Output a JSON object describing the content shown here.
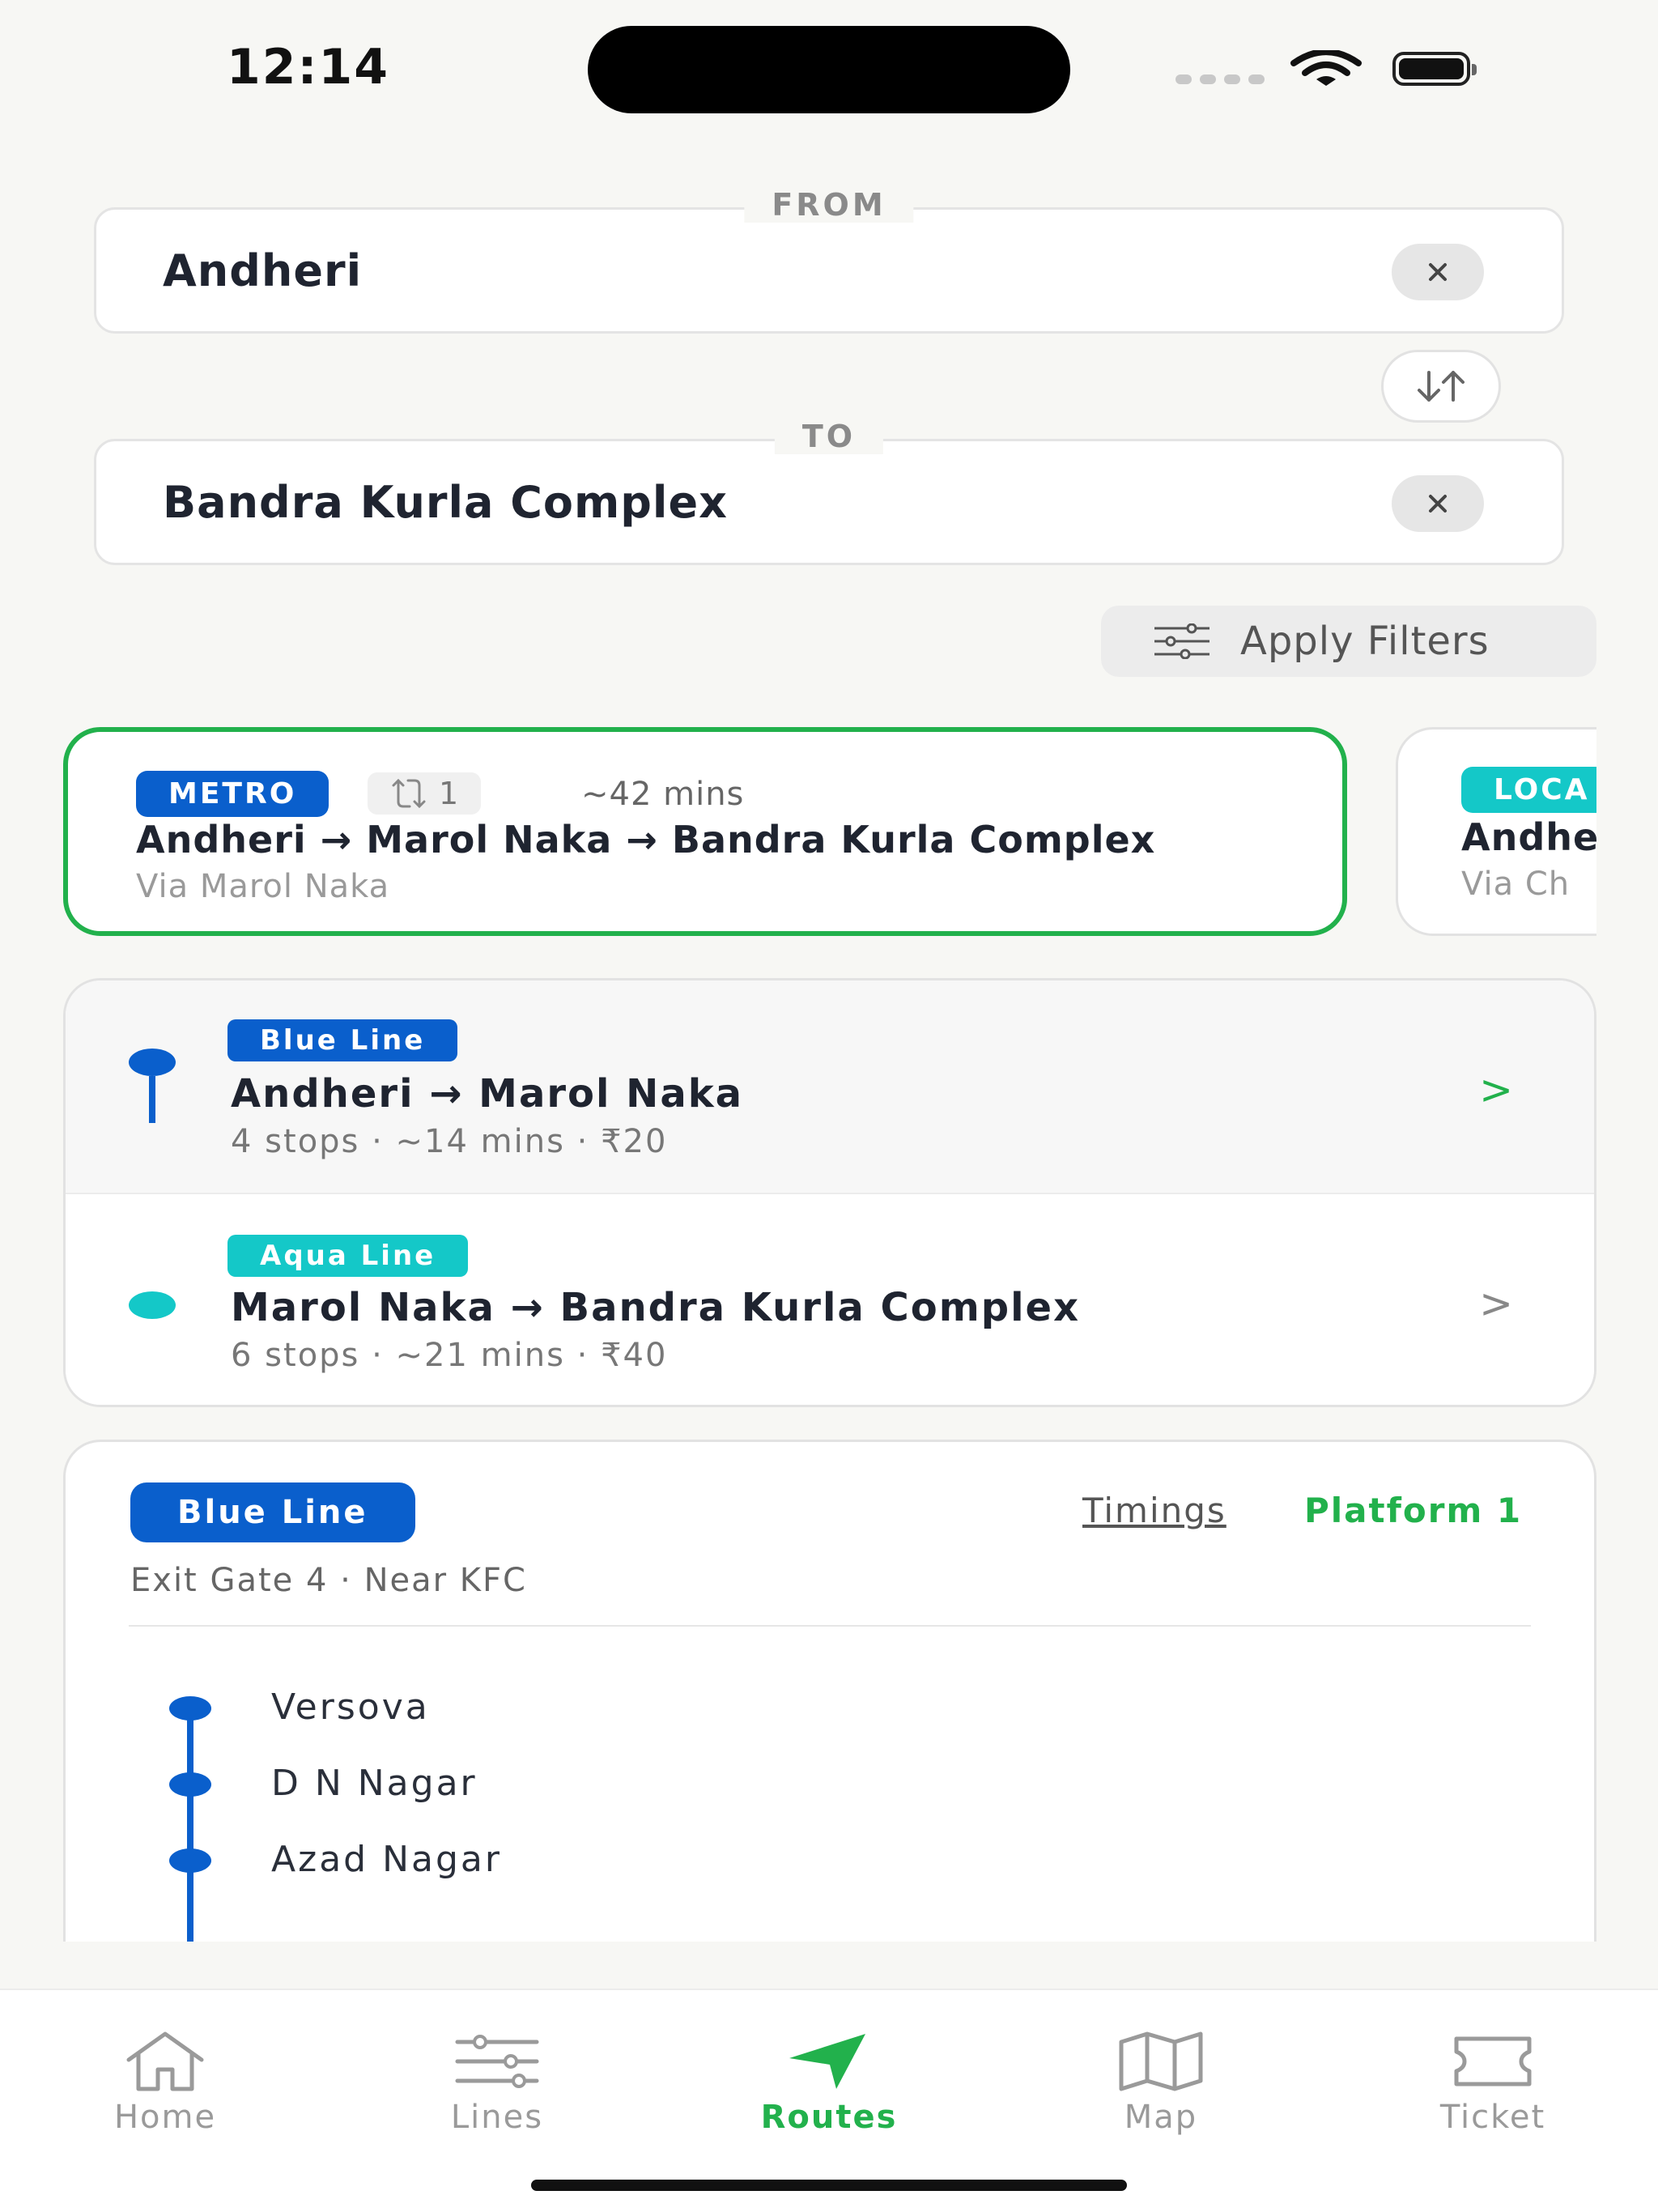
{
  "status": {
    "time": "12:14"
  },
  "from": {
    "legend": "FROM",
    "value": "Andheri"
  },
  "to": {
    "legend": "TO",
    "value": "Bandra Kurla Complex"
  },
  "filters": {
    "label": "Apply Filters"
  },
  "routes": [
    {
      "mode": "METRO",
      "transfers": "1",
      "duration": "~42 mins",
      "path": "Andheri → Marol Naka → Bandra Kurla Complex",
      "via": "Via Marol Naka",
      "selected": true
    },
    {
      "mode": "LOCA",
      "path": "Andhe",
      "via": "Via Ch",
      "selected": false
    }
  ],
  "legs": [
    {
      "line": "Blue Line",
      "color": "#0a5fcc",
      "title": "Andheri → Marol Naka",
      "meta": "4 stops · ~14 mins · ₹20"
    },
    {
      "line": "Aqua Line",
      "color": "#14c8c8",
      "title": "Marol Naka → Bandra Kurla Complex",
      "meta": "6 stops · ~21 mins · ₹40"
    }
  ],
  "line_detail": {
    "line": "Blue Line",
    "timings": "Timings",
    "platform": "Platform 1",
    "exit": "Exit Gate 4 · Near KFC",
    "stations": [
      "Versova",
      "D N Nagar",
      "Azad Nagar"
    ]
  },
  "tabs": [
    {
      "label": "Home",
      "icon": "home-icon"
    },
    {
      "label": "Lines",
      "icon": "sliders-icon"
    },
    {
      "label": "Routes",
      "icon": "navigation-arrow-icon",
      "active": true
    },
    {
      "label": "Map",
      "icon": "map-icon"
    },
    {
      "label": "Ticket",
      "icon": "ticket-icon"
    }
  ],
  "colors": {
    "accent": "#22b14c",
    "blue_line": "#0a5fcc",
    "aqua_line": "#14c8c8"
  }
}
